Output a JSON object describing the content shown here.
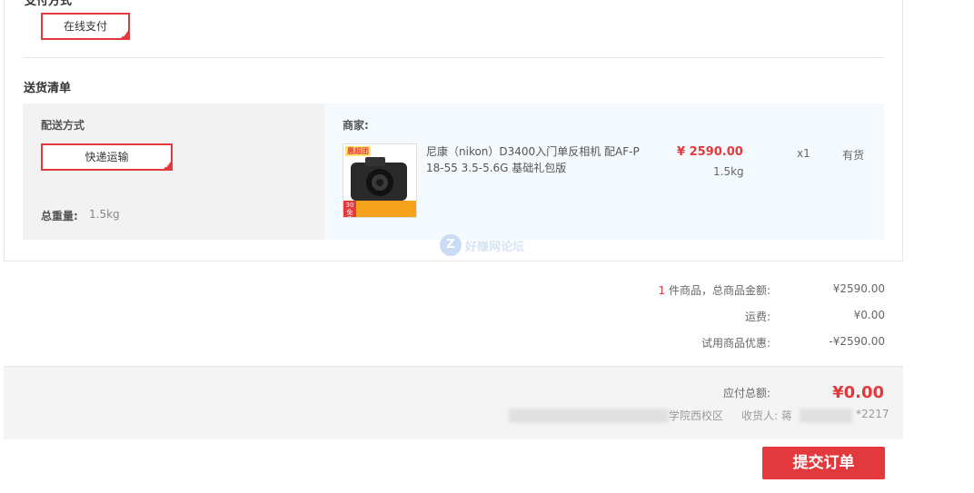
{
  "payment": {
    "section_title": "支付方式",
    "option_label": "在线支付"
  },
  "shipping": {
    "section_title": "送货清单",
    "method_label": "配送方式",
    "method_option": "快递运输",
    "total_weight_label": "总重量:",
    "total_weight_value": "1.5kg",
    "merchant_label": "商家:",
    "product": {
      "name": "尼康（nikon）D3400入门单反相机 配AF-P 18-55 3.5-5.6G 基础礼包版",
      "price": "¥ 2590.00",
      "weight": "1.5kg",
      "quantity": "x1",
      "stock": "有货",
      "badge_top": "惠超团",
      "badge_corner_line1": "30",
      "badge_corner_line2": "免息"
    }
  },
  "watermark": {
    "text": "好赚网论坛",
    "logo": "Z"
  },
  "summary": {
    "count": "1",
    "count_label": "件商品，总商品金额:",
    "goods_total": "¥2590.00",
    "freight_label": "运费:",
    "freight_value": "¥0.00",
    "discount_label": "试用商品优惠:",
    "discount_value": "-¥2590.00",
    "payable_label": "应付总额:",
    "payable_value": "¥0.00",
    "address_suffix": "学院西校区",
    "receiver_label": "收货人: 蒋",
    "phone_suffix": "*2217"
  },
  "submit_label": "提交订单",
  "colors": {
    "accent": "#e4393c",
    "panel_left": "#f2f2f2",
    "panel_right": "#f3f9fd"
  }
}
